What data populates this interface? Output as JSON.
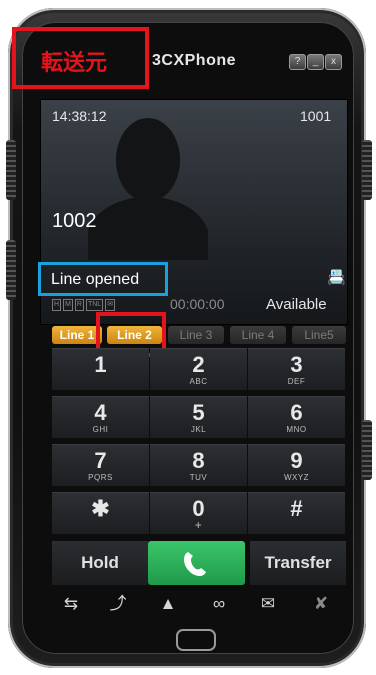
{
  "annotation": {
    "from_label": "転送元"
  },
  "app": {
    "title": "3CXPhone",
    "window_buttons": [
      "?",
      "_",
      "x"
    ]
  },
  "screen": {
    "time": "14:38:12",
    "own_extension": "1001",
    "remote_party": "1002",
    "status": "Line opened",
    "timer": "00:00:00",
    "presence": "Available",
    "indicators": [
      "H",
      "M",
      "R",
      "TNL",
      "✉"
    ]
  },
  "lines": [
    {
      "label": "Line 1",
      "active": true
    },
    {
      "label": "Line 2",
      "active": true
    },
    {
      "label": "Line 3",
      "active": false
    },
    {
      "label": "Line 4",
      "active": false
    },
    {
      "label": "Line5",
      "active": false
    }
  ],
  "keypad": [
    {
      "digit": "1",
      "letters": ""
    },
    {
      "digit": "2",
      "letters": "ABC"
    },
    {
      "digit": "3",
      "letters": "DEF"
    },
    {
      "digit": "4",
      "letters": "GHI"
    },
    {
      "digit": "5",
      "letters": "JKL"
    },
    {
      "digit": "6",
      "letters": "MNO"
    },
    {
      "digit": "7",
      "letters": "PQRS"
    },
    {
      "digit": "8",
      "letters": "TUV"
    },
    {
      "digit": "9",
      "letters": "WXYZ"
    },
    {
      "digit": "✱",
      "letters": ""
    },
    {
      "digit": "0",
      "letters": "+"
    },
    {
      "digit": "#",
      "letters": ""
    }
  ],
  "controls": {
    "hold": "Hold",
    "transfer": "Transfer"
  },
  "icons": {
    "call": "phone-handset-icon",
    "toolbar": [
      "call-forward-icon",
      "pickup-icon",
      "contact-icon",
      "voicemail-icon",
      "missed-call-icon",
      "mute-icon"
    ]
  },
  "colors": {
    "line_active": "#e3a025",
    "call_green": "#2cb158",
    "annot_red": "#e3141b",
    "annot_blue": "#1aa1dd"
  }
}
